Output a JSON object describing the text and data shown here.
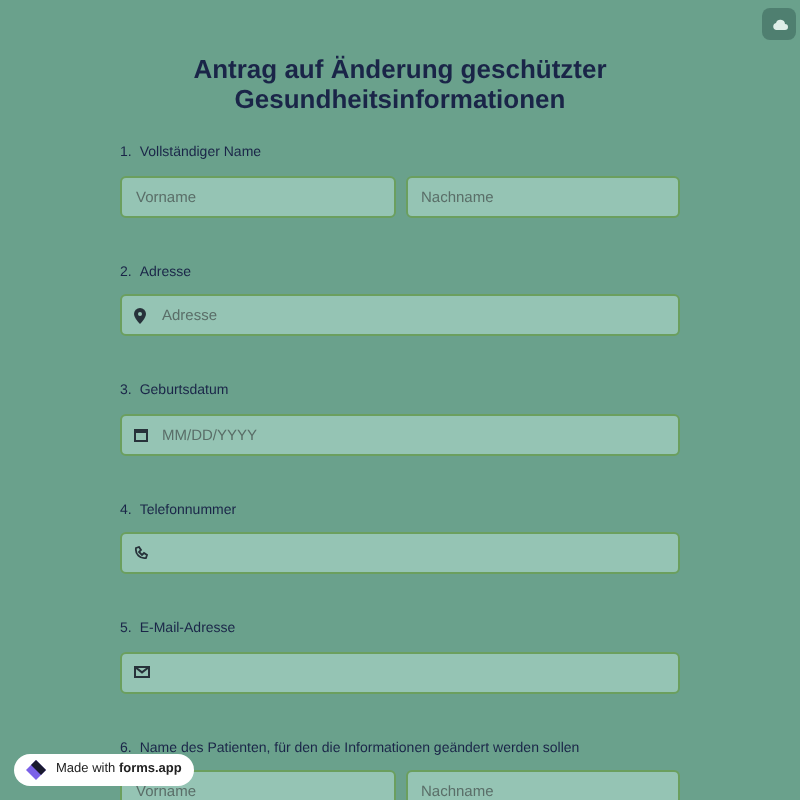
{
  "title": "Antrag auf Änderung geschützter Gesundheitsinformationen",
  "questions": [
    {
      "number": "1.",
      "label": "Vollständiger Name",
      "kind": "name",
      "fields": [
        {
          "placeholder": "Vorname"
        },
        {
          "placeholder": "Nachname"
        }
      ]
    },
    {
      "number": "2.",
      "label": "Adresse",
      "kind": "address",
      "fields": [
        {
          "placeholder": "Adresse"
        }
      ]
    },
    {
      "number": "3.",
      "label": "Geburtsdatum",
      "kind": "date",
      "fields": [
        {
          "placeholder": "MM/DD/YYYY"
        }
      ]
    },
    {
      "number": "4.",
      "label": "Telefonnummer",
      "kind": "phone"
    },
    {
      "number": "5.",
      "label": "E-Mail-Adresse",
      "kind": "email"
    },
    {
      "number": "6.",
      "label": "Name des Patienten, für den die Informationen geändert werden sollen",
      "kind": "name",
      "fields": [
        {
          "placeholder": "Vorname"
        },
        {
          "placeholder": "Nachname"
        }
      ]
    }
  ],
  "badge": {
    "text_before": "Made with",
    "text_bold": "forms.app"
  }
}
